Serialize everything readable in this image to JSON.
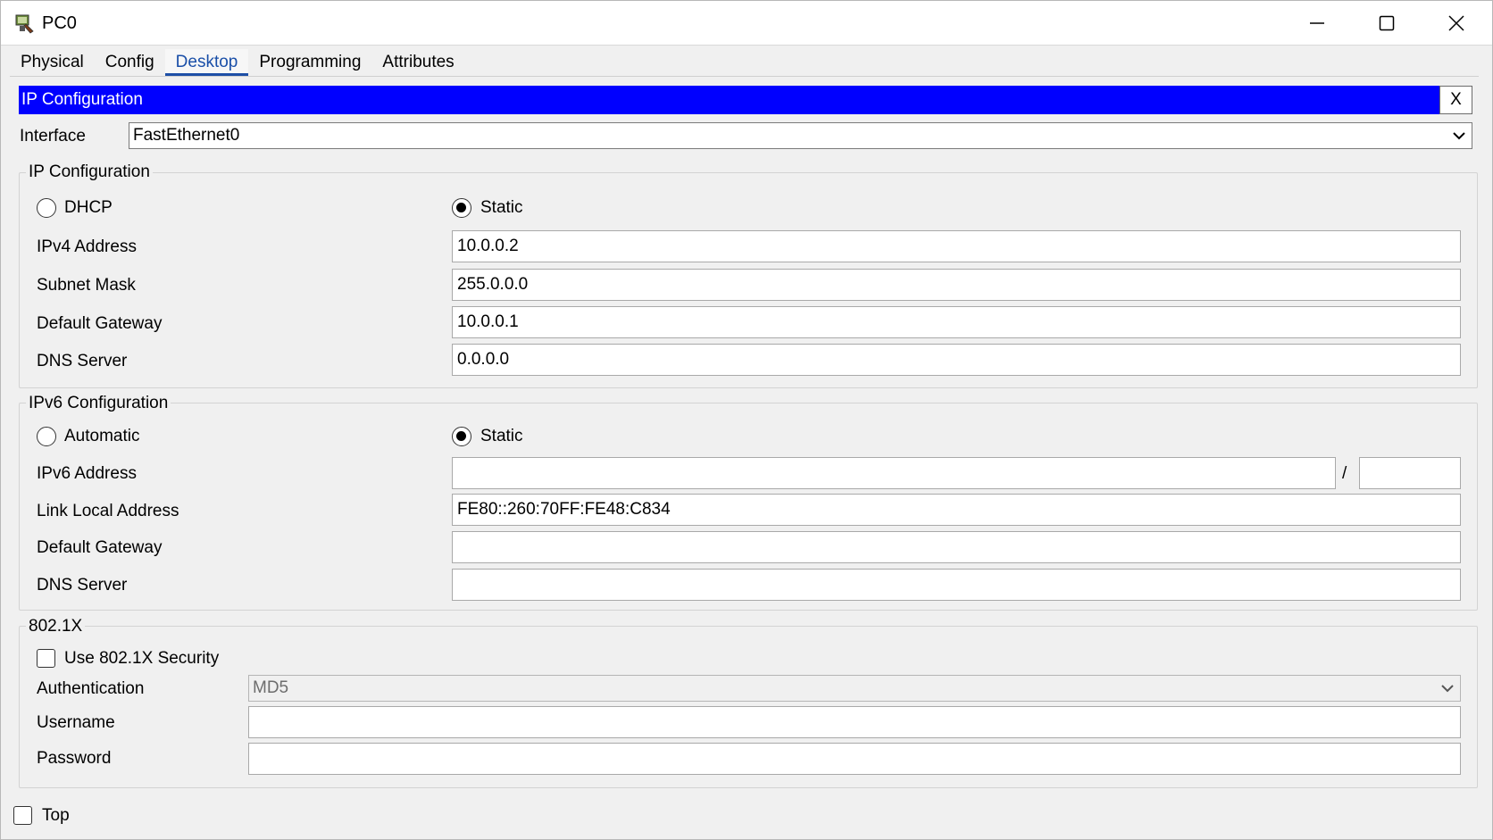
{
  "window": {
    "title": "PC0",
    "minimize_icon": "minimize-icon",
    "maximize_icon": "maximize-icon",
    "close_icon": "close-icon"
  },
  "tabs": [
    {
      "label": "Physical",
      "active": false
    },
    {
      "label": "Config",
      "active": false
    },
    {
      "label": "Desktop",
      "active": true
    },
    {
      "label": "Programming",
      "active": false
    },
    {
      "label": "Attributes",
      "active": false
    }
  ],
  "ip_config_panel": {
    "title": "IP Configuration",
    "close_label": "X",
    "header_color": "#0000ff",
    "interface": {
      "label": "Interface",
      "value": "FastEthernet0"
    }
  },
  "ipv4": {
    "legend": "IP Configuration",
    "dhcp_label": "DHCP",
    "static_label": "Static",
    "mode": "Static",
    "fields": {
      "address": {
        "label": "IPv4 Address",
        "value": "10.0.0.2"
      },
      "mask": {
        "label": "Subnet Mask",
        "value": "255.0.0.0"
      },
      "gateway": {
        "label": "Default Gateway",
        "value": "10.0.0.1"
      },
      "dns": {
        "label": "DNS Server",
        "value": "0.0.0.0"
      }
    }
  },
  "ipv6": {
    "legend": "IPv6 Configuration",
    "automatic_label": "Automatic",
    "static_label": "Static",
    "mode": "Static",
    "prefix_separator": "/",
    "fields": {
      "address": {
        "label": "IPv6 Address",
        "value": "",
        "prefix": ""
      },
      "link_local": {
        "label": "Link Local Address",
        "value": "FE80::260:70FF:FE48:C834"
      },
      "gateway": {
        "label": "Default Gateway",
        "value": ""
      },
      "dns": {
        "label": "DNS Server",
        "value": ""
      }
    }
  },
  "dot1x": {
    "legend": "802.1X",
    "use_security_label": "Use 802.1X Security",
    "use_security_checked": false,
    "authentication": {
      "label": "Authentication",
      "value": "MD5"
    },
    "username": {
      "label": "Username",
      "value": ""
    },
    "password": {
      "label": "Password",
      "value": ""
    }
  },
  "footer": {
    "top_label": "Top",
    "top_checked": false
  }
}
